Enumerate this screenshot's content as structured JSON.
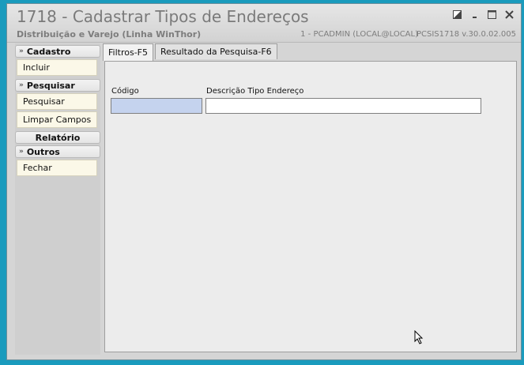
{
  "window": {
    "title": "1718 - Cadastrar Tipos de Endereços",
    "subtitle": "Distribuição e Varejo (Linha WinThor)",
    "user_info": "1 - PCADMIN (LOCAL@LOCAL)",
    "version": "PCSIS1718  v.30.0.02.005"
  },
  "sidebar": {
    "sections": [
      {
        "header": "Cadastro",
        "items": [
          "Incluir"
        ]
      },
      {
        "header": "Pesquisar",
        "items": [
          "Pesquisar",
          "Limpar Campos"
        ]
      },
      {
        "header": "Relatório",
        "items": []
      },
      {
        "header": "Outros",
        "items": [
          "Fechar"
        ]
      }
    ]
  },
  "tabs": [
    {
      "label": "Filtros-F5",
      "active": true
    },
    {
      "label": "Resultado da Pesquisa-F6",
      "active": false
    }
  ],
  "filters": {
    "codigo_label": "Código",
    "codigo_value": "",
    "descricao_label": "Descrição Tipo Endereço",
    "descricao_value": ""
  },
  "colors": {
    "desktop": "#1a9bbd",
    "focused_input": "#c5d3ee",
    "sidebar_item": "#fbf8e8"
  },
  "icons": [
    "restore-icon",
    "minimize-icon",
    "maximize-icon",
    "close-icon",
    "chevron-double-down-icon",
    "mouse-pointer-icon"
  ]
}
